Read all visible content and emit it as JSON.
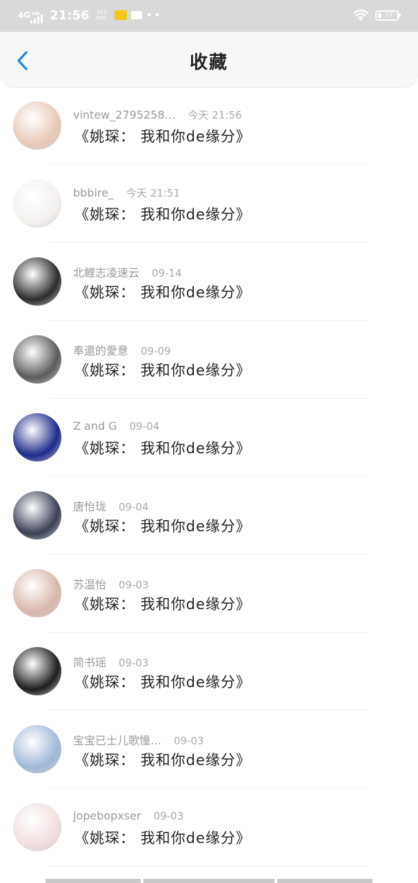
{
  "status_bar": {
    "network": "4G",
    "network_sup": "HD",
    "time": "21:56",
    "speed_value": "33.4",
    "speed_unit": "KB/s",
    "battery": "17",
    "colors": {
      "background": "#d9d9d9",
      "foreground": "#ffffff"
    }
  },
  "header": {
    "back_icon": "chevron-left-icon",
    "title": "收藏",
    "accent": "#1e88e5"
  },
  "favorites": [
    {
      "user": "vintew_2795258…",
      "time": "今天 21:56",
      "content": "《姚琛： 我和你de缘分》"
    },
    {
      "user": "bbbire_",
      "time": "今天 21:51",
      "content": "《姚琛： 我和你de缘分》"
    },
    {
      "user": "北鲤志凌速云",
      "time": "09-14",
      "content": "《姚琛： 我和你de缘分》"
    },
    {
      "user": "奉還的愛意",
      "time": "09-09",
      "content": "《姚琛： 我和你de缘分》"
    },
    {
      "user": "Z and G",
      "time": "09-04",
      "content": "《姚琛： 我和你de缘分》"
    },
    {
      "user": "唐怡珑",
      "time": "09-04",
      "content": "《姚琛： 我和你de缘分》"
    },
    {
      "user": "苏温怡",
      "time": "09-03",
      "content": "《姚琛： 我和你de缘分》"
    },
    {
      "user": "简书瑶",
      "time": "09-03",
      "content": "《姚琛： 我和你de缘分》"
    },
    {
      "user": "宝宝已士儿歌憧…",
      "time": "09-03",
      "content": "《姚琛： 我和你de缘分》"
    },
    {
      "user": "jopebopxser",
      "time": "09-03",
      "content": "《姚琛： 我和你de缘分》"
    }
  ],
  "avatar_colors": [
    "#e8c9b6",
    "#f4f1ef",
    "#2c2c2c",
    "#5b5b5b",
    "#1b2a8a",
    "#3a3f55",
    "#d8b7ab",
    "#1e1e1e",
    "#9fb8d8",
    "#f2dede"
  ]
}
